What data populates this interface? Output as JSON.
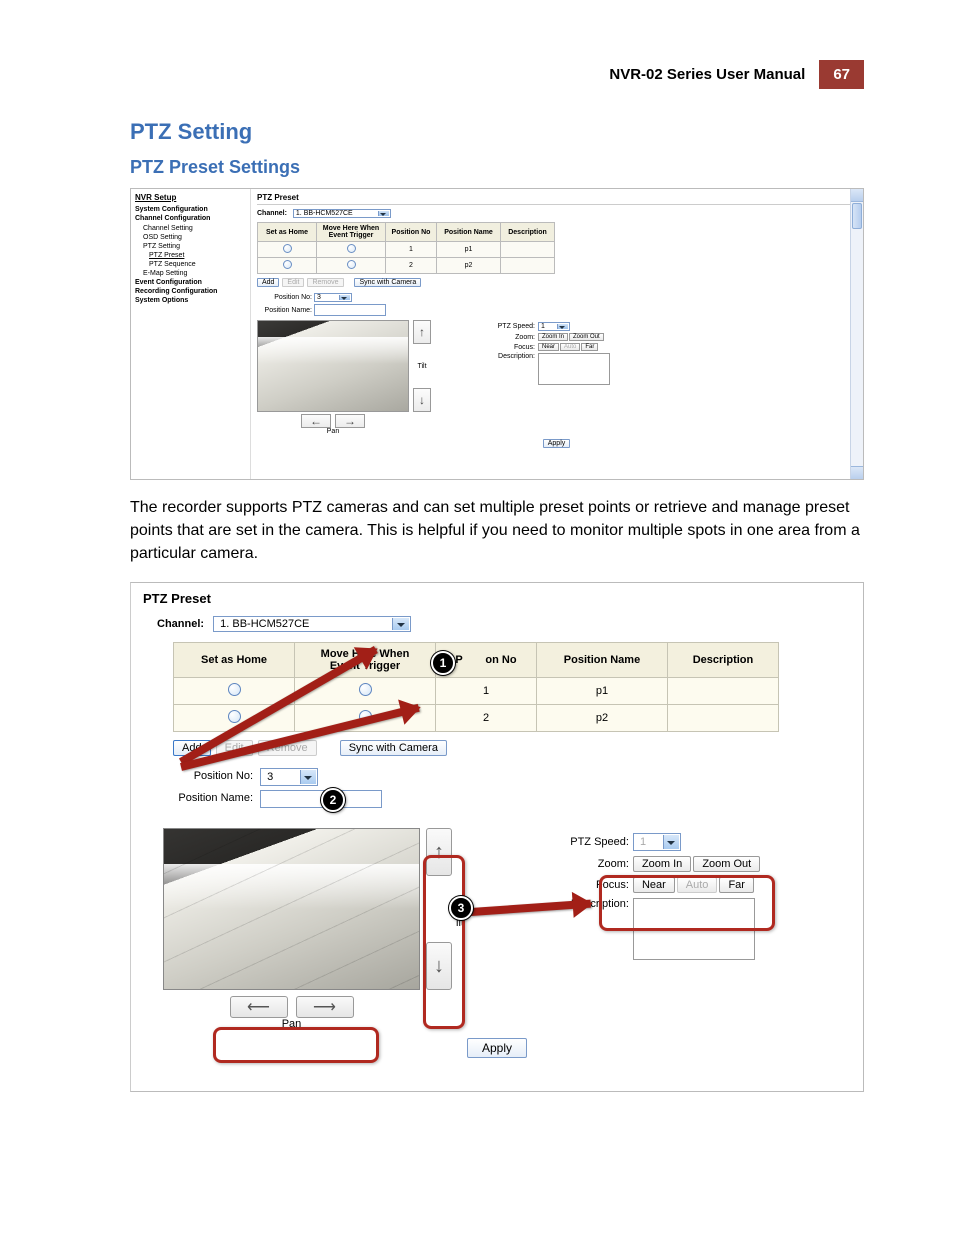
{
  "header": {
    "title": "NVR-02 Series User Manual",
    "page": "67"
  },
  "section_title": "PTZ Setting",
  "subsection_title": "PTZ Preset Settings",
  "body_paragraph": "The recorder supports PTZ cameras and can set multiple preset points or retrieve and manage preset points that are set in the camera. This is helpful if you need to monitor multiple spots in one area from a particular camera.",
  "nav": {
    "title": "NVR Setup",
    "items": [
      {
        "label": "System Configuration",
        "level": "top"
      },
      {
        "label": "Channel Configuration",
        "level": "top"
      },
      {
        "label": "Channel Setting",
        "level": "item"
      },
      {
        "label": "OSD Setting",
        "level": "item"
      },
      {
        "label": "PTZ Setting",
        "level": "item"
      },
      {
        "label": "PTZ Preset",
        "level": "sub",
        "active": true
      },
      {
        "label": "PTZ Sequence",
        "level": "sub"
      },
      {
        "label": "E-Map Setting",
        "level": "item"
      },
      {
        "label": "Event Configuration",
        "level": "top"
      },
      {
        "label": "Recording Configuration",
        "level": "top"
      },
      {
        "label": "System Options",
        "level": "top"
      }
    ]
  },
  "panel": {
    "title": "PTZ Preset",
    "channel_label": "Channel:",
    "channel_value": "1. BB-HCM527CE",
    "columns": {
      "c1": "Set as Home",
      "c2": "Move Here When Event Trigger",
      "c3": "Position No",
      "c4": "Position Name",
      "c5": "Description"
    },
    "rows": [
      {
        "pos_no": "1",
        "pos_name": "p1"
      },
      {
        "pos_no": "2",
        "pos_name": "p2"
      }
    ],
    "buttons": {
      "add": "Add",
      "edit": "Edit",
      "remove": "Remove",
      "sync": "Sync with Camera"
    },
    "position_no_label": "Position No:",
    "position_no_value": "3",
    "position_name_label": "Position Name:",
    "tilt_label": "Tilt",
    "pan_label": "Pan",
    "controls": {
      "ptz_speed_label": "PTZ Speed:",
      "ptz_speed_value": "1",
      "zoom_label": "Zoom:",
      "zoom_in": "Zoom In",
      "zoom_out": "Zoom Out",
      "focus_label": "Focus:",
      "near": "Near",
      "auto": "Auto",
      "far": "Far",
      "description_label": "Description:"
    },
    "apply": "Apply"
  },
  "callouts": {
    "n1": "1",
    "n2": "2",
    "n3": "3"
  }
}
